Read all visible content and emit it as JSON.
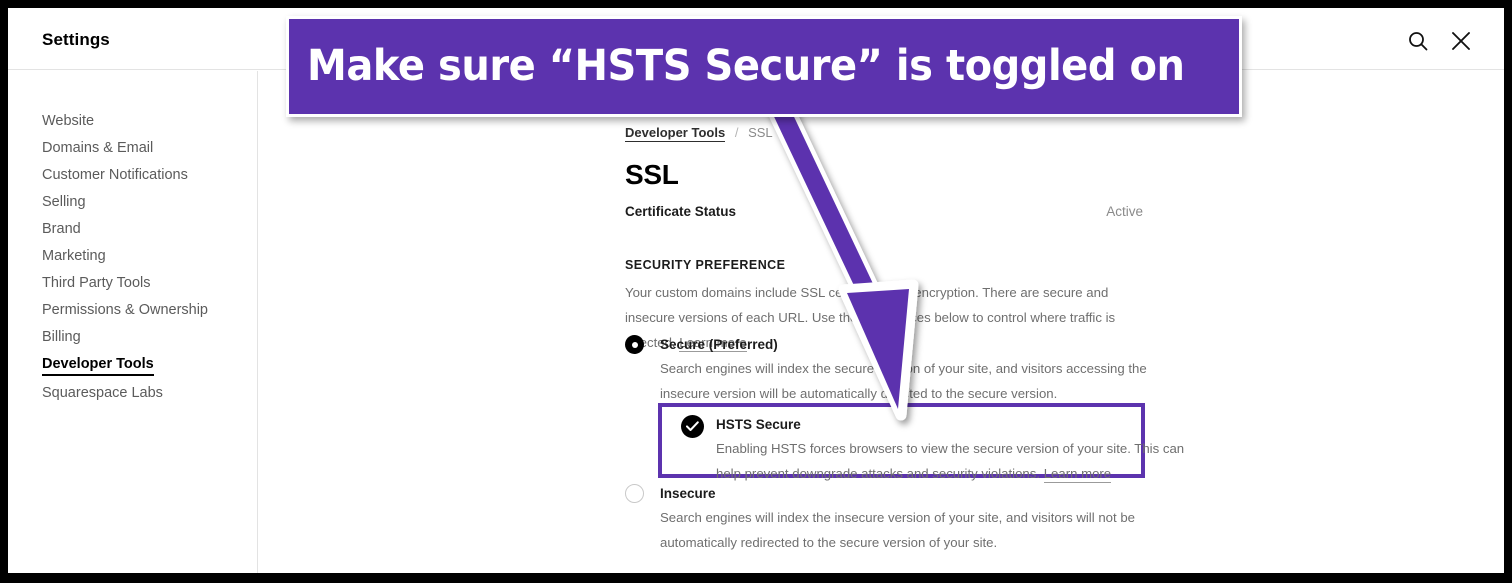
{
  "header": {
    "title": "Settings",
    "search_icon": "search-icon",
    "close_icon": "close-icon"
  },
  "sidebar": {
    "items": [
      {
        "label": "Website",
        "active": false
      },
      {
        "label": "Domains & Email",
        "active": false
      },
      {
        "label": "Customer Notifications",
        "active": false
      },
      {
        "label": "Selling",
        "active": false
      },
      {
        "label": "Brand",
        "active": false
      },
      {
        "label": "Marketing",
        "active": false
      },
      {
        "label": "Third Party Tools",
        "active": false
      },
      {
        "label": "Permissions & Ownership",
        "active": false
      },
      {
        "label": "Billing",
        "active": false
      },
      {
        "label": "Developer Tools",
        "active": true
      },
      {
        "label": "Squarespace Labs",
        "active": false
      }
    ]
  },
  "main": {
    "breadcrumb": {
      "parent": "Developer Tools",
      "separator": "/",
      "current": "SSL"
    },
    "page_title": "SSL",
    "certificate_status": {
      "label": "Certificate Status",
      "value": "Active"
    },
    "security_preference": {
      "heading": "SECURITY PREFERENCE",
      "description": "Your custom domains include SSL certificates for encryption. There are secure and insecure versions of each URL. Use the preferences below to control where traffic is directed.",
      "learn_more": "Learn more"
    },
    "options": [
      {
        "key": "secure",
        "title": "Secure (Preferred)",
        "description": "Search engines will index the secure version of your site, and visitors accessing the insecure version will be automatically directed to the secure version.",
        "control": "radio",
        "selected": true
      },
      {
        "key": "hsts",
        "title": "HSTS Secure",
        "description": "Enabling HSTS forces browsers to view the secure version of your site. This can help prevent downgrade attacks and security violations.",
        "learn_more": "Learn more",
        "control": "checkbox",
        "selected": true,
        "highlighted": true
      },
      {
        "key": "insecure",
        "title": "Insecure",
        "description": "Search engines will index the insecure version of your site, and visitors will not be automatically redirected to the secure version of your site.",
        "control": "radio",
        "selected": false
      }
    ]
  },
  "annotation": {
    "callout_text": "Make sure “HSTS Secure” is toggled on",
    "accent_color": "#5c33ae",
    "arrow": "arrow-pointing-down-right"
  }
}
